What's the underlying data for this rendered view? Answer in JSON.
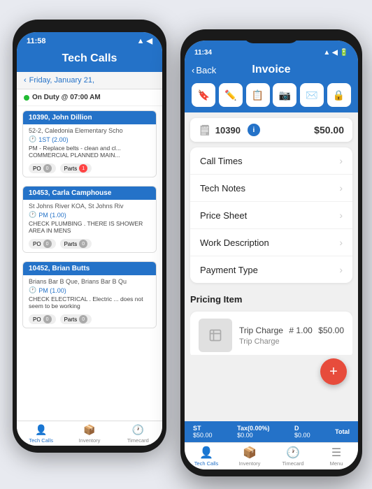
{
  "back_phone": {
    "status_bar": {
      "time": "11:58",
      "signal_icons": "▲ ◀"
    },
    "header": {
      "title": "Tech Calls"
    },
    "nav": {
      "back_icon": "‹",
      "date": "Friday, January 21,"
    },
    "duty": {
      "status": "On Duty @ 07:00 AM"
    },
    "jobs": [
      {
        "id": "10390, John Dillion",
        "location": "52-2, Caledonia Elementary Scho",
        "time": "1ST (2.00)",
        "description": "PM - Replace belts - clean and cl... COMMERCIAL PLANNED MAIN...",
        "po_count": "0",
        "parts_count": "1"
      },
      {
        "id": "10453, Carla Camphouse",
        "location": "St Johns River KOA, St Johns Riv",
        "time": "PM (1.00)",
        "description": "CHECK PLUMBING . THERE IS SHOWER AREA IN MENS",
        "po_count": "0",
        "parts_count": "0"
      },
      {
        "id": "10452, Brian Butts",
        "location": "Brians Bar B Que, Brians Bar B Qu",
        "time": "PM (1.00)",
        "description": "CHECK ELECTRICAL . Electric ... does not seem to be working",
        "po_count": "0",
        "parts_count": "0"
      }
    ],
    "tabs": [
      {
        "icon": "👤",
        "label": "Tech Calls",
        "active": true
      },
      {
        "icon": "📦",
        "label": "Inventory",
        "active": false
      },
      {
        "icon": "🕐",
        "label": "Timecard",
        "active": false
      }
    ]
  },
  "front_phone": {
    "status_bar": {
      "time": "11:34",
      "signal_icons": "▲ ◀ 🔋"
    },
    "header": {
      "back_label": "Back",
      "title": "Invoice"
    },
    "toolbar_icons": [
      "✏️",
      "✒️",
      "📋",
      "📷",
      "✉️",
      "🔒"
    ],
    "invoice": {
      "id": "10390",
      "amount": "$50.00"
    },
    "menu_items": [
      {
        "label": "Call Times"
      },
      {
        "label": "Tech Notes"
      },
      {
        "label": "Price Sheet"
      },
      {
        "label": "Work Description"
      },
      {
        "label": "Payment Type"
      }
    ],
    "pricing": {
      "section_title": "Pricing Item",
      "item": {
        "name": "Trip Charge",
        "quantity": "# 1.00",
        "amount": "$50.00",
        "sub_label": "Trip Charge"
      }
    },
    "bottom_bar": {
      "st_label": "ST",
      "st_value": "$50.00",
      "tax_label": "Tax(0.00%)",
      "tax_value": "$0.00",
      "d_label": "D",
      "d_value": "$0.00",
      "total_label": "Total"
    },
    "tabs": [
      {
        "icon": "👤",
        "label": "Tech Calls",
        "active": true
      },
      {
        "icon": "📦",
        "label": "Inventory",
        "active": false
      },
      {
        "icon": "🕐",
        "label": "Timecard",
        "active": false
      },
      {
        "icon": "☰",
        "label": "Menu",
        "active": false
      }
    ]
  },
  "colors": {
    "primary": "#2472c8",
    "danger": "#e74c3c",
    "bg": "#e8eaf0"
  }
}
